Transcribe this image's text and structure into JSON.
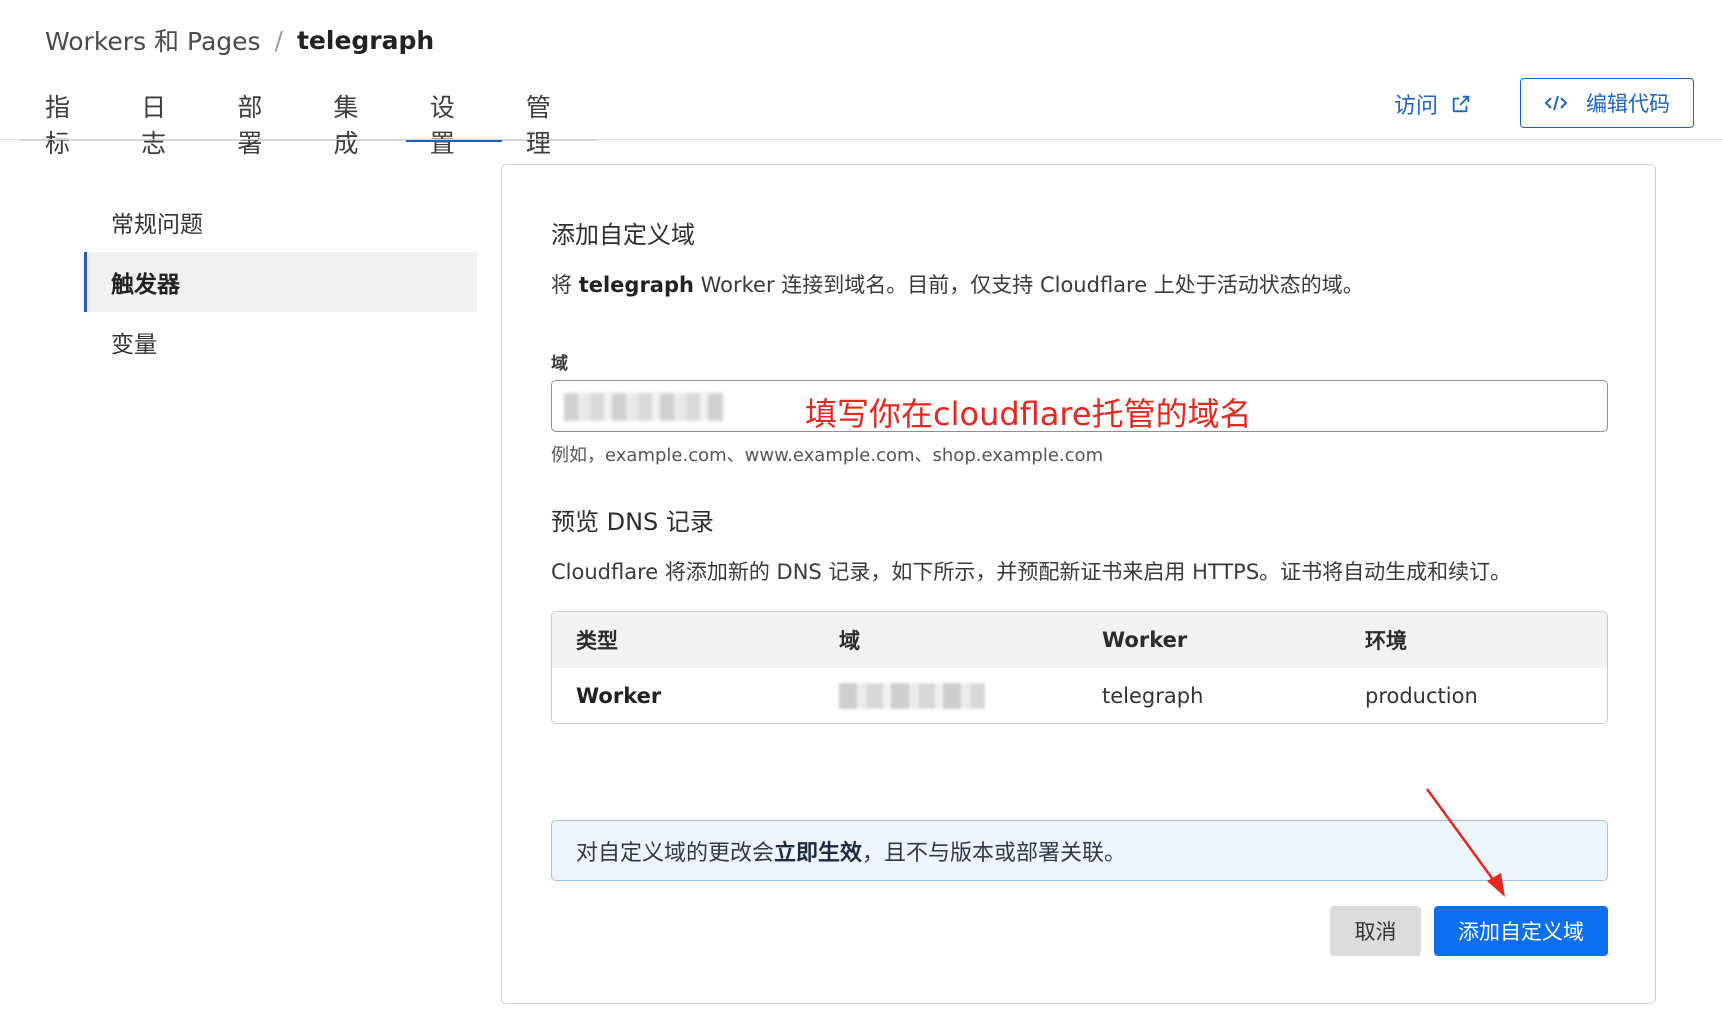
{
  "breadcrumb": {
    "parent": "Workers 和 Pages",
    "separator": "/",
    "current": "telegraph"
  },
  "tabs": [
    {
      "label": "指标"
    },
    {
      "label": "日志"
    },
    {
      "label": "部署"
    },
    {
      "label": "集成"
    },
    {
      "label": "设置",
      "active": true
    },
    {
      "label": "管理"
    }
  ],
  "header_actions": {
    "visit_label": "访问",
    "edit_code_label": "编辑代码"
  },
  "sidebar": {
    "items": [
      {
        "label": "常规问题"
      },
      {
        "label": "触发器",
        "active": true
      },
      {
        "label": "变量"
      }
    ]
  },
  "card": {
    "title": "添加自定义域",
    "desc_prefix": "将 ",
    "desc_bold": "telegraph",
    "desc_suffix": " Worker 连接到域名。目前，仅支持 Cloudflare 上处于活动状态的域。",
    "field_label": "域",
    "field_hint": "例如，example.com、www.example.com、shop.example.com",
    "annotation": "填写你在cloudflare托管的域名",
    "preview_title": "预览 DNS 记录",
    "preview_desc": "Cloudflare 将添加新的 DNS 记录，如下所示，并预配新证书来启用 HTTPS。证书将自动生成和续订。",
    "table": {
      "headers": [
        "类型",
        "域",
        "Worker",
        "环境"
      ],
      "row": {
        "type": "Worker",
        "worker": "telegraph",
        "env": "production"
      }
    },
    "notice_prefix": "对自定义域的更改会",
    "notice_bold": "立即生效",
    "notice_suffix": "，且不与版本或部署关联。",
    "cancel_label": "取消",
    "submit_label": "添加自定义域"
  },
  "colors": {
    "accent": "#0b6ff0",
    "link": "#1a63c9",
    "annotation": "#e8271e",
    "notice_bg": "#eef5fd"
  }
}
